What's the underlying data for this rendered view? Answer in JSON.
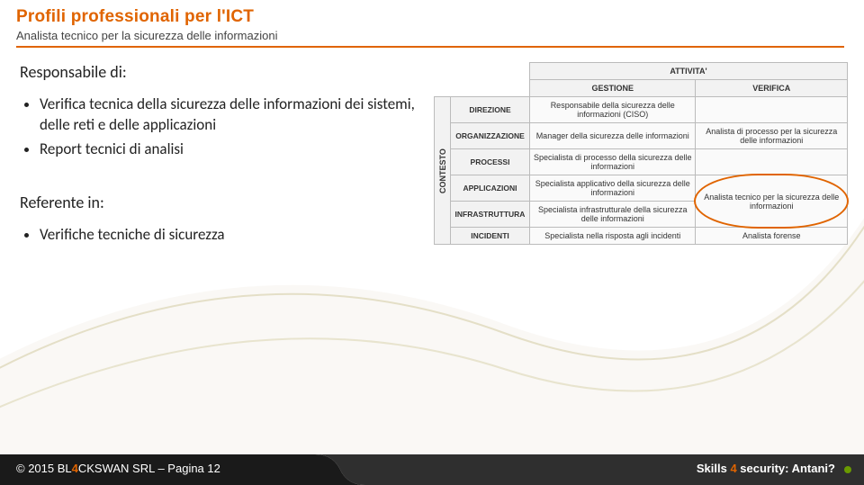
{
  "header": {
    "title": "Profili professionali per l'ICT",
    "subtitle": "Analista tecnico per la sicurezza delle informazioni"
  },
  "content": {
    "resp_heading": "Responsabile di:",
    "resp_items": [
      "Verifica tecnica della sicurezza delle informazioni dei sistemi, delle reti e delle applicazioni",
      "Report tecnici di analisi"
    ],
    "ref_heading": "Referente in:",
    "ref_items": [
      "Verifiche tecniche di sicurezza"
    ]
  },
  "matrix": {
    "super_header": "ATTIVITA'",
    "col_headers": [
      "GESTIONE",
      "VERIFICA"
    ],
    "row_group_label": "CONTESTO",
    "rows": [
      {
        "label": "DIREZIONE",
        "gestione": "Responsabile della sicurezza delle informazioni (CISO)",
        "verifica": ""
      },
      {
        "label": "ORGANIZZAZIONE",
        "gestione": "Manager della sicurezza delle informazioni",
        "verifica": "Analista di processo per la sicurezza delle informazioni"
      },
      {
        "label": "PROCESSI",
        "gestione": "Specialista di processo della sicurezza delle informazioni",
        "verifica": ""
      },
      {
        "label": "APPLICAZIONI",
        "gestione": "Specialista applicativo della sicurezza delle informazioni",
        "verifica": ""
      },
      {
        "label": "INFRASTRUTTURA",
        "gestione": "Specialista infrastrutturale della sicurezza delle informazioni",
        "verifica": "Analista tecnico per la sicurezza delle informazioni"
      },
      {
        "label": "INCIDENTI",
        "gestione": "Specialista nella risposta agli incidenti",
        "verifica": "Analista forense"
      }
    ]
  },
  "footer": {
    "copyright_pre": "© 2015 BL",
    "four": "4",
    "copyright_post": "CKSWAN SRL – Pagina 12",
    "right_pre": "Skills ",
    "right_four": "4",
    "right_post": " security: Antani?"
  }
}
